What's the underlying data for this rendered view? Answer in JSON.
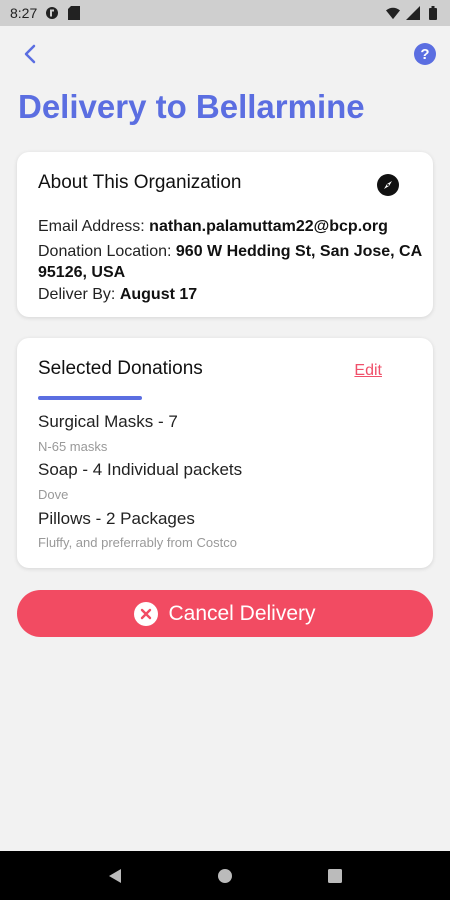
{
  "status_bar": {
    "time": "8:27"
  },
  "header": {
    "title": "Delivery to Bellarmine"
  },
  "organization": {
    "title": "About This Organization",
    "email_label": "Email Address:",
    "email": "nathan.palamuttam22@bcp.org",
    "location_label": "Donation Location:",
    "location": "960 W Hedding St, San Jose, CA 95126, USA",
    "deliver_label": "Deliver By:",
    "deliver_by": "August 17"
  },
  "donations": {
    "title": "Selected Donations",
    "edit_label": "Edit",
    "items": [
      {
        "name": "Surgical Masks - 7",
        "note": "N-65 masks"
      },
      {
        "name": "Soap - 4 Individual packets",
        "note": "Dove"
      },
      {
        "name": "Pillows - 2 Packages",
        "note": "Fluffy, and preferrably from Costco"
      }
    ]
  },
  "actions": {
    "cancel_label": "Cancel Delivery"
  },
  "colors": {
    "accent": "#5b6ee1",
    "danger": "#f24b62"
  }
}
